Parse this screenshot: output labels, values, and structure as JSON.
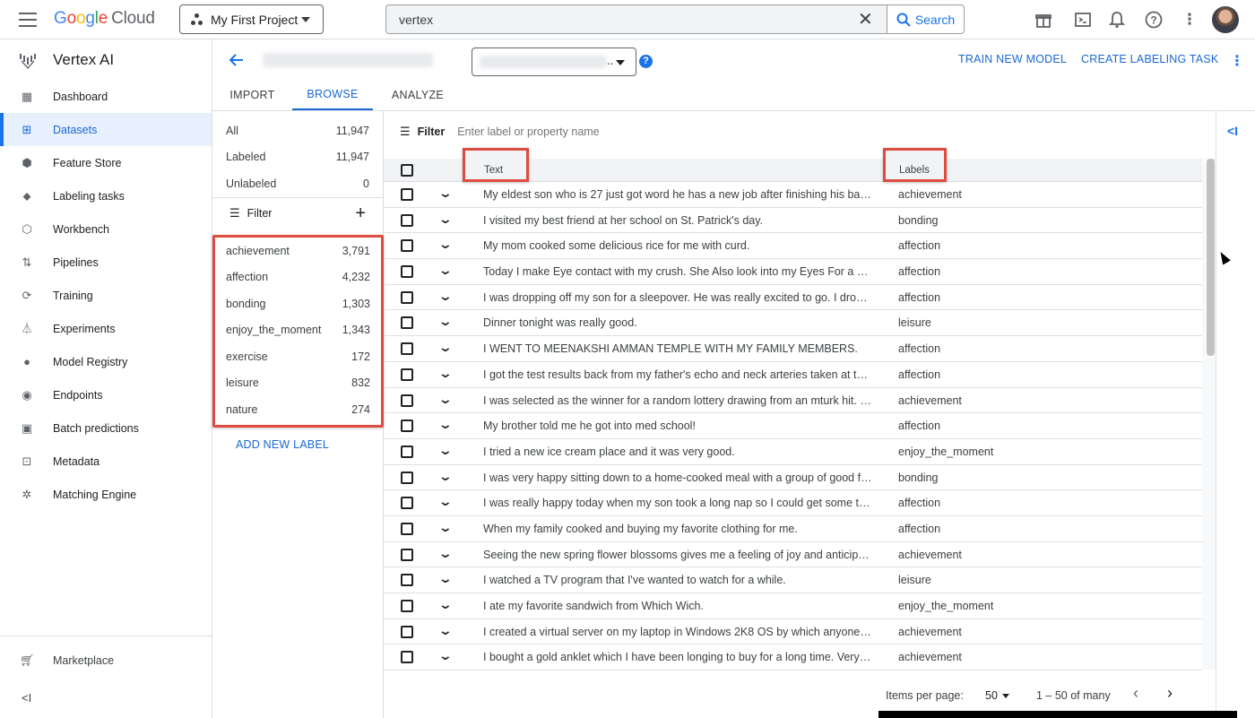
{
  "topbar": {
    "logo_google": [
      "G",
      "o",
      "o",
      "g",
      "l",
      "e"
    ],
    "logo_cloud": "Cloud",
    "project": "My First Project",
    "search_value": "vertex",
    "search_button": "Search"
  },
  "sidebar": {
    "title": "Vertex AI",
    "items": [
      {
        "label": "Dashboard",
        "icon": "dashboard-icon",
        "glyph": "▦"
      },
      {
        "label": "Datasets",
        "icon": "datasets-icon",
        "glyph": "⊞",
        "active": true
      },
      {
        "label": "Feature Store",
        "icon": "feature-store-icon",
        "glyph": "⬢"
      },
      {
        "label": "Labeling tasks",
        "icon": "label-icon",
        "glyph": "⬥"
      },
      {
        "label": "Workbench",
        "icon": "workbench-icon",
        "glyph": "⬡"
      },
      {
        "label": "Pipelines",
        "icon": "pipelines-icon",
        "glyph": "⇅"
      },
      {
        "label": "Training",
        "icon": "training-icon",
        "glyph": "⟳"
      },
      {
        "label": "Experiments",
        "icon": "flask-icon",
        "glyph": "⏃"
      },
      {
        "label": "Model Registry",
        "icon": "bulb-icon",
        "glyph": "●"
      },
      {
        "label": "Endpoints",
        "icon": "endpoint-icon",
        "glyph": "◉"
      },
      {
        "label": "Batch predictions",
        "icon": "batch-icon",
        "glyph": "▣"
      },
      {
        "label": "Metadata",
        "icon": "metadata-icon",
        "glyph": "⊡"
      },
      {
        "label": "Matching Engine",
        "icon": "matching-engine-icon",
        "glyph": "✲"
      }
    ],
    "marketplace": "Marketplace",
    "collapse": "<I"
  },
  "header": {
    "train_new_model": "TRAIN NEW MODEL",
    "create_labeling_task": "CREATE LABELING TASK"
  },
  "tabs": [
    "IMPORT",
    "BROWSE",
    "ANALYZE"
  ],
  "counts": [
    {
      "label": "All",
      "value": "11,947"
    },
    {
      "label": "Labeled",
      "value": "11,947"
    },
    {
      "label": "Unlabeled",
      "value": "0"
    }
  ],
  "left_filter": "Filter",
  "labels": [
    {
      "name": "achievement",
      "count": "3,791"
    },
    {
      "name": "affection",
      "count": "4,232"
    },
    {
      "name": "bonding",
      "count": "1,303"
    },
    {
      "name": "enjoy_the_moment",
      "count": "1,343"
    },
    {
      "name": "exercise",
      "count": "172"
    },
    {
      "name": "leisure",
      "count": "832"
    },
    {
      "name": "nature",
      "count": "274"
    }
  ],
  "add_new_label": "ADD NEW LABEL",
  "main_filter": {
    "label": "Filter",
    "placeholder": "Enter label or property name"
  },
  "columns": {
    "text": "Text",
    "labels": "Labels"
  },
  "rows": [
    {
      "text": "My eldest son who is 27 just got word he has a new job after finishing his bache...",
      "label": "achievement"
    },
    {
      "text": "I visited my best friend at her school on St. Patrick's day.",
      "label": "bonding"
    },
    {
      "text": "My mom cooked some delicious rice for me with curd.",
      "label": "affection"
    },
    {
      "text": "Today I make Eye contact with my crush. She Also look into my Eyes For a Seco...",
      "label": "affection"
    },
    {
      "text": "I was dropping off my son for a sleepover. He was really excited to go. I droppe...",
      "label": "affection"
    },
    {
      "text": "Dinner tonight was really good.",
      "label": "leisure"
    },
    {
      "text": "I WENT TO MEENAKSHI AMMAN TEMPLE WITH MY FAMILY MEMBERS.",
      "label": "affection"
    },
    {
      "text": "I got the test results back from my father's echo and neck arteries taken at the ...",
      "label": "affection"
    },
    {
      "text": "I was selected as the winner for a random lottery drawing from an mturk hit. It ...",
      "label": "achievement"
    },
    {
      "text": "My brother told me he got into med school!",
      "label": "affection"
    },
    {
      "text": "I tried a new ice cream place and it was very good.",
      "label": "enjoy_the_moment"
    },
    {
      "text": "I was very happy sitting down to a home-cooked meal with a group of good frie...",
      "label": "bonding"
    },
    {
      "text": "I was really happy today when my son took a long nap so I could get some thing...",
      "label": "affection"
    },
    {
      "text": "When my family cooked and buying my favorite clothing for me.",
      "label": "affection"
    },
    {
      "text": "Seeing the new spring flower blossoms gives me a feeling of joy and anticipatio...",
      "label": "achievement"
    },
    {
      "text": "I watched a TV program that I've wanted to watch for a while.",
      "label": "leisure"
    },
    {
      "text": "I ate my favorite sandwich from Which Wich.",
      "label": "enjoy_the_moment"
    },
    {
      "text": "I created a virtual server on my laptop in Windows 2K8 OS by which anyone can ...",
      "label": "achievement"
    },
    {
      "text": "I bought a gold anklet which I have been longing to buy for a long time. Very hap...",
      "label": "achievement"
    }
  ],
  "pager": {
    "items_per_page_label": "Items per page:",
    "items_per_page": "50",
    "range": "1 – 50 of many"
  },
  "colors": {
    "accent": "#1a73e8",
    "highlight": "#e04b3f"
  }
}
